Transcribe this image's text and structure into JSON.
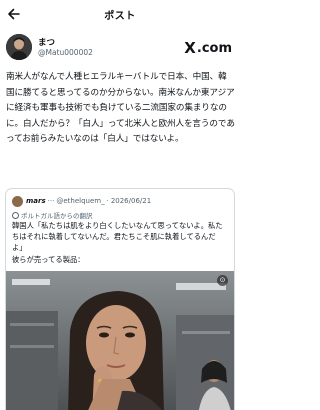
{
  "nav": {
    "title": "ポスト"
  },
  "author": {
    "name": "まつ",
    "handle": "@Matu000002",
    "badge_text": ".com",
    "badge_mark": "X"
  },
  "post": {
    "text": "南米人がなんで人種ヒエラルキーバトルで日本、中国、韓国に勝てると思ってるのか分からない。南米なんか東アジアに経済も軍事も技術でも負けている二流国家の集まりなのに。白人だから？「白人」って北米人と欧州人を言うのであってお前らみたいなのは「白人」ではないよ。"
  },
  "quote": {
    "name": "mars",
    "dots": "···",
    "handle": "@ethelquem_",
    "separator": "·",
    "date": "2026/06/21",
    "translated_label": "ポルトガル語からの翻訳",
    "text": "韓国人「私たちは肌をより白くしたいなんて思ってないよ。私たちはそれに執着してないんだ。君たちこそ肌に執着してるんだよ」\n彼らが売ってる製品："
  },
  "icons": {
    "back": "arrow-left-icon",
    "translate": "globe-icon",
    "media_badge": "media-info-icon"
  },
  "colors": {
    "text": "#0f1419",
    "secondary": "#536471",
    "border": "#cfd9de"
  }
}
